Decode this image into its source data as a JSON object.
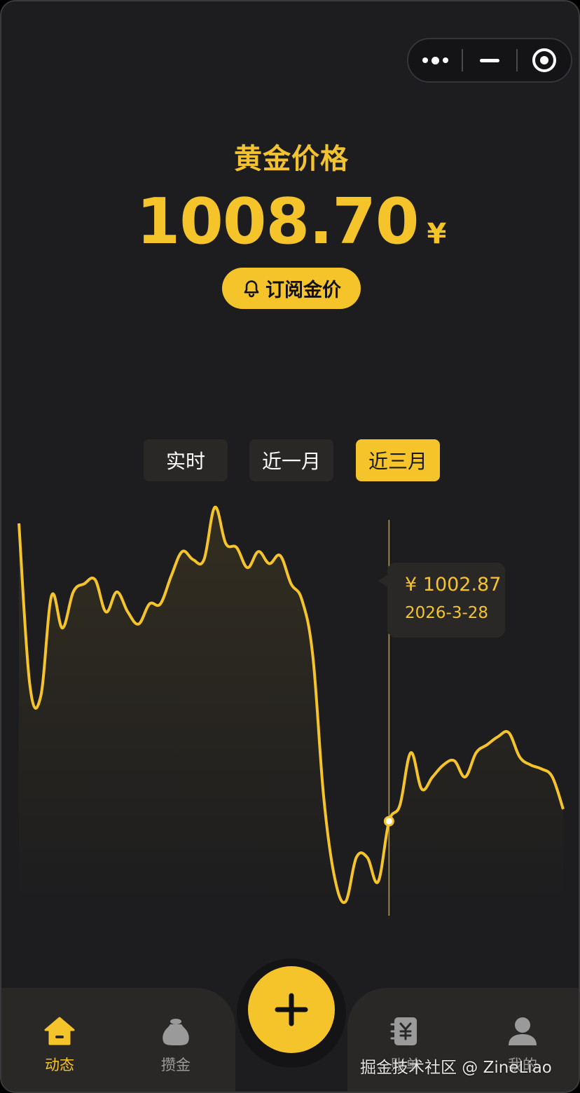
{
  "header": {
    "title": "黄金价格",
    "price": "1008.70",
    "currency": "¥",
    "subscribe_label": "订阅金价"
  },
  "range_tabs": [
    {
      "label": "实时",
      "active": false
    },
    {
      "label": "近一月",
      "active": false
    },
    {
      "label": "近三月",
      "active": true
    }
  ],
  "tooltip": {
    "price": "¥ 1002.87",
    "date": "2026-3-28"
  },
  "chart_data": {
    "type": "line",
    "title": "",
    "xlabel": "",
    "ylabel": "",
    "grid": false,
    "series": [
      {
        "values": [
          1076,
          1036,
          1033,
          1058,
          1050,
          1059,
          1061,
          1062,
          1054,
          1059,
          1054,
          1051,
          1056,
          1056,
          1063,
          1069,
          1067,
          1067,
          1080,
          1071,
          1070,
          1065,
          1069,
          1066,
          1068,
          1061,
          1057,
          1043,
          1008,
          988,
          982,
          993,
          993,
          987,
          1002,
          1006,
          1019,
          1010,
          1013,
          1016,
          1017,
          1013,
          1019,
          1021,
          1023,
          1024,
          1018,
          1016,
          1015,
          1013,
          1005
        ]
      }
    ],
    "highlight": {
      "index": 34,
      "value": 1002.87,
      "date": "2026-3-28"
    },
    "colors": {
      "line": "#f5c42a",
      "area": "#f5c42a"
    }
  },
  "tabbar": {
    "items": [
      {
        "label": "动态",
        "icon": "home-icon",
        "active": true
      },
      {
        "label": "攒金",
        "icon": "money-bag-icon",
        "active": false
      },
      {
        "label": "账单",
        "icon": "bill-icon",
        "active": false
      },
      {
        "label": "我的",
        "icon": "user-icon",
        "active": false
      }
    ],
    "fab_icon": "plus-icon"
  },
  "watermark": "掘金技术社区 @ ZineLiao",
  "colors": {
    "accent": "#f5c42a",
    "background": "#1d1d1f",
    "panel": "#2a2826"
  }
}
